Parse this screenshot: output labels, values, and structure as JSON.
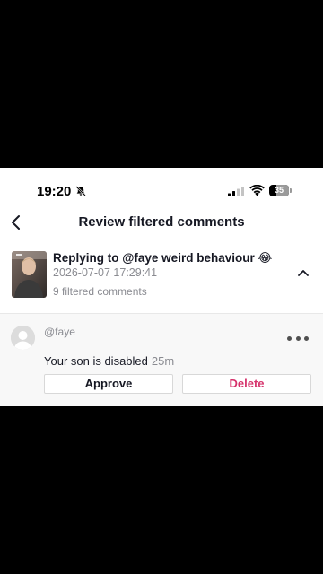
{
  "status_bar": {
    "time": "19:20",
    "battery": "35",
    "battery_level": 0.35
  },
  "header": {
    "title": "Review filtered comments"
  },
  "video": {
    "reply_title": "Replying to @faye weird behaviour 😂",
    "date": "2026-07-07 17:29:41",
    "filtered_count": "9 filtered comments"
  },
  "comment": {
    "username": "@faye",
    "text": "Your son is disabled",
    "time": "25m",
    "approve_label": "Approve",
    "delete_label": "Delete"
  },
  "colors": {
    "delete": "#d6336c",
    "secondary_text": "#8a8b91",
    "primary_text": "#161823"
  },
  "icons": [
    "bell-off-icon",
    "signal-icon",
    "wifi-icon",
    "battery-icon",
    "chevron-left-icon",
    "chevron-up-icon",
    "more-icon",
    "avatar-placeholder-icon"
  ]
}
